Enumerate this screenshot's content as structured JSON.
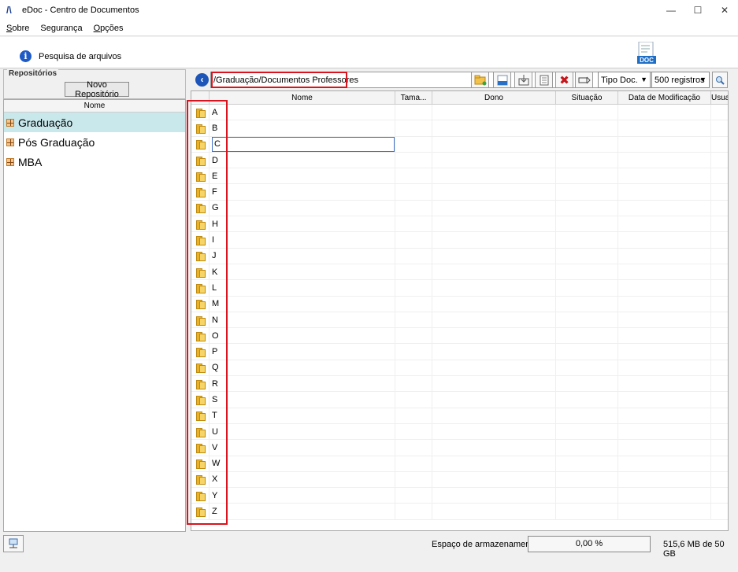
{
  "window": {
    "title": "eDoc - Centro de Documentos",
    "controls": [
      "—",
      "☐",
      "✕"
    ]
  },
  "menu": {
    "items": [
      {
        "first": "S",
        "rest": "obre"
      },
      {
        "first": "",
        "rest": "Segurança"
      },
      {
        "first": "O",
        "rest": "pções"
      }
    ]
  },
  "info": {
    "text": "Pesquisa de arquivos",
    "logo_text": "DOC"
  },
  "repositories": {
    "legend": "Repositórios",
    "new_button": "Novo Repositório",
    "column_header": "Nome",
    "items": [
      {
        "label": "Graduação",
        "selected": true
      },
      {
        "label": "Pós Graduação",
        "selected": false
      },
      {
        "label": "MBA",
        "selected": false
      }
    ]
  },
  "toolbar": {
    "path": "/Graduação/Documentos Professores",
    "doc_type": "Tipo Doc.",
    "records": "500 registros"
  },
  "grid": {
    "columns": [
      "",
      "Nome",
      "Tama...",
      "Dono",
      "Situação",
      "Data de Modificação",
      "Usuar"
    ],
    "rows": [
      "A",
      "B",
      "C",
      "D",
      "E",
      "F",
      "G",
      "H",
      "I",
      "J",
      "K",
      "L",
      "M",
      "N",
      "O",
      "P",
      "Q",
      "R",
      "S",
      "T",
      "U",
      "V",
      "W",
      "X",
      "Y",
      "Z"
    ],
    "editing_row": "C"
  },
  "status": {
    "storage_label": "Espaço de armazenamento:",
    "percent": "0,00 %",
    "size": "515,6 MB  de 50 GB"
  }
}
